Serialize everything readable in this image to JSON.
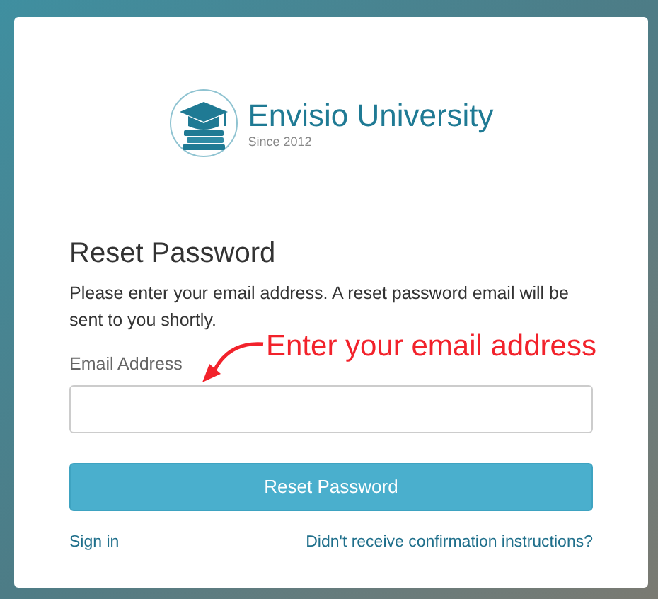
{
  "logo": {
    "name": "Envisio University",
    "tagline": "Since 2012"
  },
  "heading": "Reset Password",
  "description": "Please enter your email address. A reset password email will be sent to you shortly.",
  "email_field": {
    "label": "Email Address"
  },
  "submit_button": "Reset Password",
  "links": [
    "Sign in",
    "Didn't receive confirmation instructions?"
  ],
  "annotation": {
    "text": "Enter your email address"
  }
}
